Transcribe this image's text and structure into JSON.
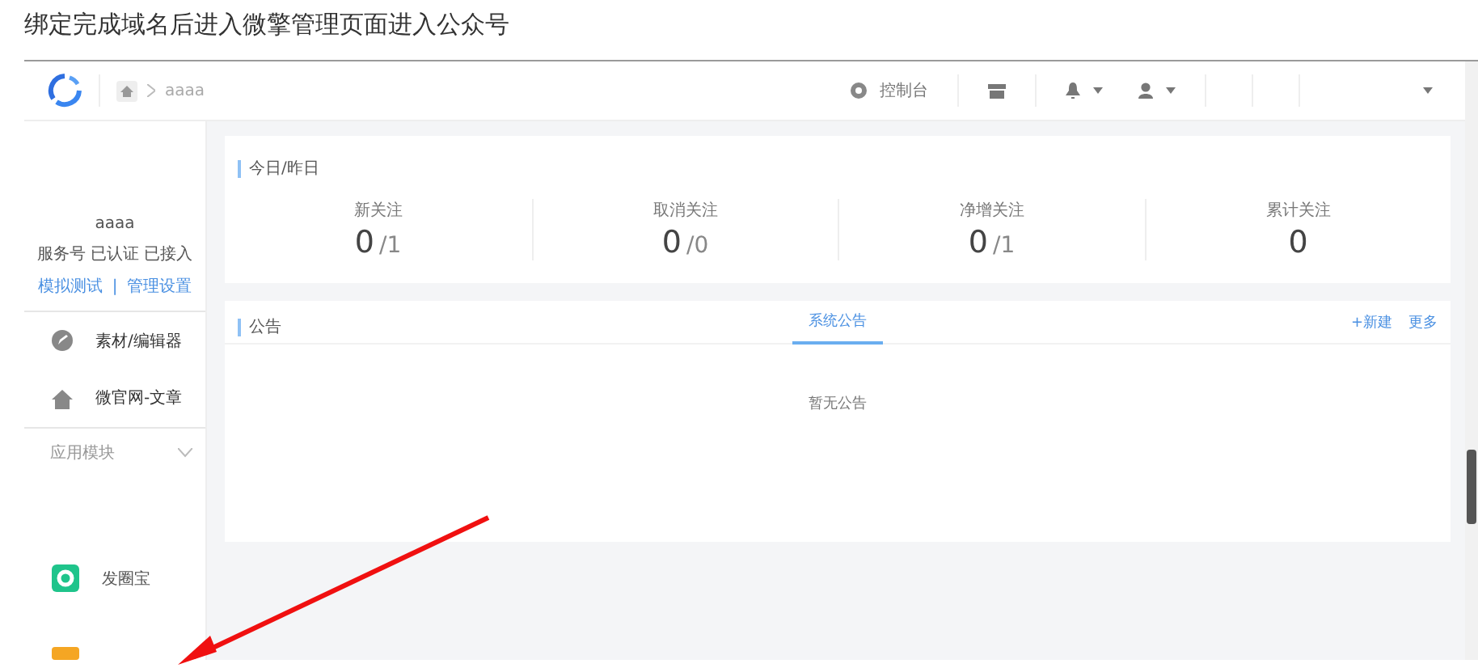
{
  "caption": "绑定完成域名后进入微擎管理页面进入公众号",
  "header": {
    "breadcrumb": "aaaa",
    "console": "控制台"
  },
  "sidebar": {
    "account_name": "aaaa",
    "account_status": "服务号 已认证 已接入",
    "links": [
      "模拟测试",
      "管理设置"
    ],
    "link_separator": "|",
    "menu": [
      {
        "kind": "edit",
        "label": "素材/编辑器"
      },
      {
        "kind": "home",
        "label": "微官网-文章"
      }
    ],
    "section": {
      "label": "应用模块",
      "expanded": true
    },
    "apps": [
      {
        "kind": "green",
        "label": "发圈宝"
      },
      {
        "kind": "orange"
      }
    ]
  },
  "stats_card": {
    "title": "今日/昨日",
    "stats": [
      {
        "label": "新关注",
        "value": "0",
        "previous": "/1"
      },
      {
        "label": "取消关注",
        "value": "0",
        "previous": "/0"
      },
      {
        "label": "净增关注",
        "value": "0",
        "previous": "/1"
      },
      {
        "label": "累计关注",
        "value": "0"
      }
    ]
  },
  "notice_card": {
    "title": "公告",
    "tabs": [
      {
        "label": "系统公告",
        "selected": true
      }
    ],
    "actions": [
      "+新建",
      "更多"
    ],
    "empty": "暂无公告"
  }
}
